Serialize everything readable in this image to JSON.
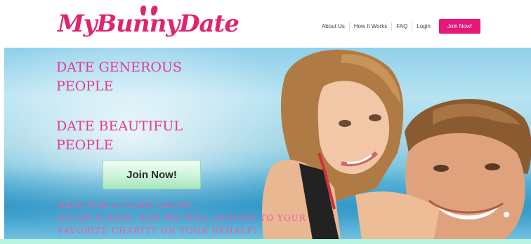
{
  "header": {
    "logo_text": "MyBunnyDate",
    "nav": {
      "about": "About Us",
      "how": "How It Works",
      "faq": "FAQ",
      "login": "Login",
      "join": "Join Now!"
    }
  },
  "hero": {
    "headline1_l1": "DATE GENEROUS",
    "headline1_l2": "PEOPLE",
    "headline2_l1": "DATE BEAUTIFUL",
    "headline2_l2": "PEOPLE",
    "join_button": "Join Now!",
    "cause_l1": "DATE FOR A GOOD CAUSE,",
    "cause_l2": "GO ON A DATE- AND WE WILL DONATE TO YOUR",
    "cause_l3": "FAVORITE CHARITY ON YOUR BEHALF!"
  },
  "colors": {
    "brand_pink": "#e8177a",
    "headline_pink": "#e43a92",
    "button_green": "#c9f1d6"
  }
}
